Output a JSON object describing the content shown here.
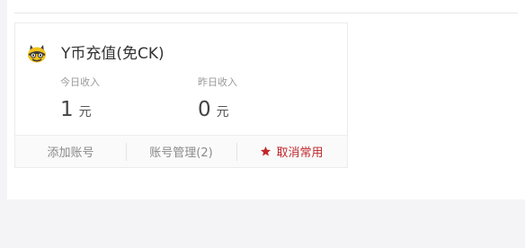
{
  "card": {
    "title": "Y币充值(免CK)",
    "logo_icon": "mascot-logo-icon",
    "today": {
      "label": "今日收入",
      "value": "1",
      "unit": "元"
    },
    "yesterday": {
      "label": "昨日收入",
      "value": "0",
      "unit": "元"
    },
    "actions": {
      "add_account": "添加账号",
      "manage_accounts": "账号管理(2)",
      "unfavorite": "取消常用",
      "unfavorite_icon": "star-icon"
    }
  },
  "colors": {
    "accent": "#c0282c",
    "text_primary": "#333333",
    "text_muted": "#999999",
    "page_background": "#f4f4f6"
  }
}
